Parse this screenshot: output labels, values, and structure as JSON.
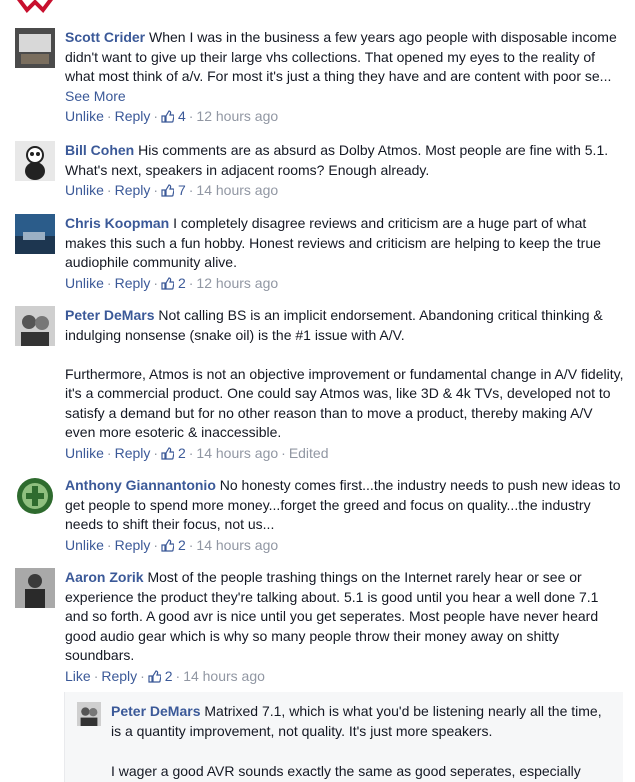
{
  "comments": [
    {
      "author": "Scott Crider",
      "text": "When I was in the business a few years ago people with disposable income didn't want to give up their large vhs collections. That opened my eyes to the reality of what most think of a/v. For most it's just a thing they have and are content with poor se...",
      "see_more": "See More",
      "like_label": "Unlike",
      "reply_label": "Reply",
      "likes": "4",
      "time": "12 hours ago"
    },
    {
      "author": "Bill Cohen",
      "text": "His comments are as absurd as Dolby Atmos. Most people are fine with 5.1. What's next, speakers in adjacent rooms? Enough already.",
      "like_label": "Unlike",
      "reply_label": "Reply",
      "likes": "7",
      "time": "14 hours ago"
    },
    {
      "author": "Chris Koopman",
      "text": "I completely disagree reviews and criticism are a huge part of what makes this such a fun hobby. Honest reviews and criticism are helping to keep the true audiophile community alive.",
      "like_label": "Unlike",
      "reply_label": "Reply",
      "likes": "2",
      "time": "12 hours ago"
    },
    {
      "author": "Peter DeMars",
      "text": "Not calling BS is an implicit endorsement. Abandoning critical thinking & indulging nonsense (snake oil) is the #1 issue with A/V.\n\nFurthermore, Atmos is not an objective improvement or fundamental change in A/V fidelity, it's a commercial product. One could say Atmos was, like 3D & 4k TVs, developed not to satisfy a demand but for no other reason than to move a product, thereby making A/V even more esoteric & inaccessible.",
      "like_label": "Unlike",
      "reply_label": "Reply",
      "likes": "2",
      "time": "14 hours ago",
      "edited": "Edited"
    },
    {
      "author": "Anthony Giannantonio",
      "text": "No honesty comes first...the industry needs to push new ideas to get people to spend more money...forget the greed and focus on quality...the industry needs to shift their focus, not us...",
      "like_label": "Unlike",
      "reply_label": "Reply",
      "likes": "2",
      "time": "14 hours ago"
    },
    {
      "author": "Aaron Zorik",
      "text": "Most of the people trashing things on the Internet rarely hear or see or experience the product they're talking about. 5.1 is good until you hear a well done 7.1 and so forth. A good avr is nice until you get seperates. Most people have never heard good audio gear which is why so many people throw their money away on shitty soundbars.",
      "like_label": "Like",
      "reply_label": "Reply",
      "likes": "2",
      "time": "14 hours ago"
    }
  ],
  "reply": {
    "author": "Peter DeMars",
    "text": "Matrixed 7.1, which is what you'd be listening nearly all the time, is a quantity improvement, not quality. It's just more speakers.\n\nI wager a good AVR sounds exactly the same as good seperates, especially"
  },
  "colors": {
    "link": "#3b5998",
    "meta": "#9197a3",
    "text": "#141823"
  },
  "icons": [
    "thumbs-up-icon",
    "avatar-image"
  ]
}
